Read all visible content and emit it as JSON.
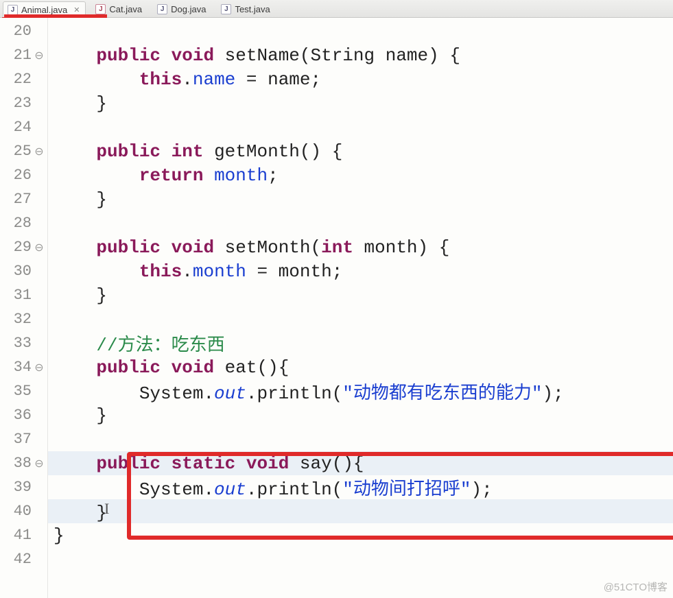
{
  "tabs": [
    {
      "label": "Animal.java",
      "active": true,
      "iconType": "java"
    },
    {
      "label": "Cat.java",
      "active": false,
      "iconType": "java-mod"
    },
    {
      "label": "Dog.java",
      "active": false,
      "iconType": "java"
    },
    {
      "label": "Test.java",
      "active": false,
      "iconType": "java"
    }
  ],
  "gutter": {
    "start": 20,
    "end": 42,
    "foldMarkers": [
      21,
      25,
      29,
      34,
      38
    ]
  },
  "code": {
    "l20": "",
    "l21_indent": "    ",
    "l21_kw1": "public",
    "l21_kw2": "void",
    "l21_name": " setName(String name) {",
    "l22_indent": "        ",
    "l22_this": "this",
    "l22_dot": ".",
    "l22_field": "name",
    "l22_rest": " = name;",
    "l23": "    }",
    "l24": "",
    "l25_indent": "    ",
    "l25_kw1": "public",
    "l25_kw2": "int",
    "l25_name": " getMonth() {",
    "l26_indent": "        ",
    "l26_ret": "return",
    "l26_sp": " ",
    "l26_field": "month",
    "l26_semi": ";",
    "l27": "    }",
    "l28": "",
    "l29_indent": "    ",
    "l29_kw1": "public",
    "l29_kw2": "void",
    "l29_name": " setMonth(",
    "l29_kw3": "int",
    "l29_rest": " month) {",
    "l30_indent": "        ",
    "l30_this": "this",
    "l30_dot": ".",
    "l30_field": "month",
    "l30_rest": " = month;",
    "l31": "    }",
    "l32": "",
    "l33_indent": "    ",
    "l33_comment": "//方法：吃东西",
    "l34_indent": "    ",
    "l34_kw1": "public",
    "l34_kw2": "void",
    "l34_name": " eat(){",
    "l35_indent": "        ",
    "l35_sys": "System.",
    "l35_out": "out",
    "l35_print": ".println(",
    "l35_str": "\"动物都有吃东西的能力\"",
    "l35_end": ");",
    "l36": "    }",
    "l37": "",
    "l38_indent": "    ",
    "l38_kw1": "public",
    "l38_kw2": "static",
    "l38_kw3": "void",
    "l38_name": " say(){",
    "l39_indent": "        ",
    "l39_sys": "System.",
    "l39_out": "out",
    "l39_print": ".println(",
    "l39_str": "\"动物间打招呼\"",
    "l39_end": ");",
    "l40": "    }",
    "l41": "}",
    "l42": ""
  },
  "highlightedLines": [
    38,
    40
  ],
  "watermark": "@51CTO博客"
}
